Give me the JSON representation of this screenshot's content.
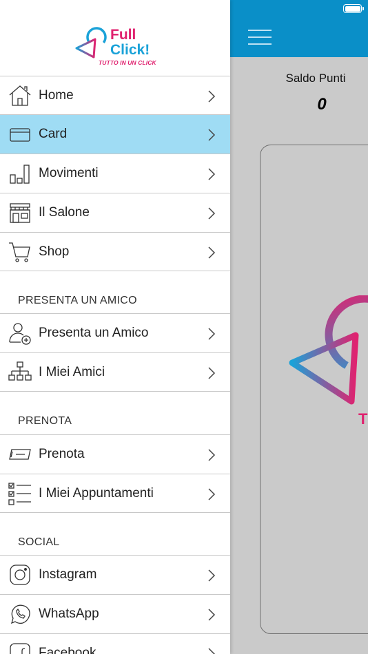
{
  "status_bar": {
    "battery_level": 1.0
  },
  "brand": {
    "line1": "Full",
    "line2": "Click!",
    "tagline": "TUTTO IN UN CLICK",
    "colors": {
      "pink": "#e0226f",
      "blue": "#1aa2d8"
    }
  },
  "menu": {
    "main_items": [
      {
        "label": "Home",
        "icon": "home-icon"
      },
      {
        "label": "Card",
        "icon": "card-icon",
        "active": true
      },
      {
        "label": "Movimenti",
        "icon": "bar-chart-icon"
      },
      {
        "label": "Il Salone",
        "icon": "store-icon"
      },
      {
        "label": "Shop",
        "icon": "cart-icon"
      }
    ],
    "section_friend": {
      "title": "PRESENTA UN AMICO",
      "items": [
        {
          "label": "Presenta un Amico",
          "icon": "add-person-icon"
        },
        {
          "label": "I Miei Amici",
          "icon": "org-chart-icon"
        }
      ]
    },
    "section_book": {
      "title": "PRENOTA",
      "items": [
        {
          "label": "Prenota",
          "icon": "ticket-icon"
        },
        {
          "label": "I Miei Appuntamenti",
          "icon": "checklist-icon"
        }
      ]
    },
    "section_social": {
      "title": "SOCIAL",
      "items": [
        {
          "label": "Instagram",
          "icon": "instagram-icon"
        },
        {
          "label": "WhatsApp",
          "icon": "whatsapp-icon"
        },
        {
          "label": "Facebook",
          "icon": "facebook-icon"
        }
      ]
    }
  },
  "main": {
    "header_color": "#0a8fc8",
    "points_label": "Saldo Punti",
    "points_value": "0",
    "card_logo_text": "T"
  }
}
